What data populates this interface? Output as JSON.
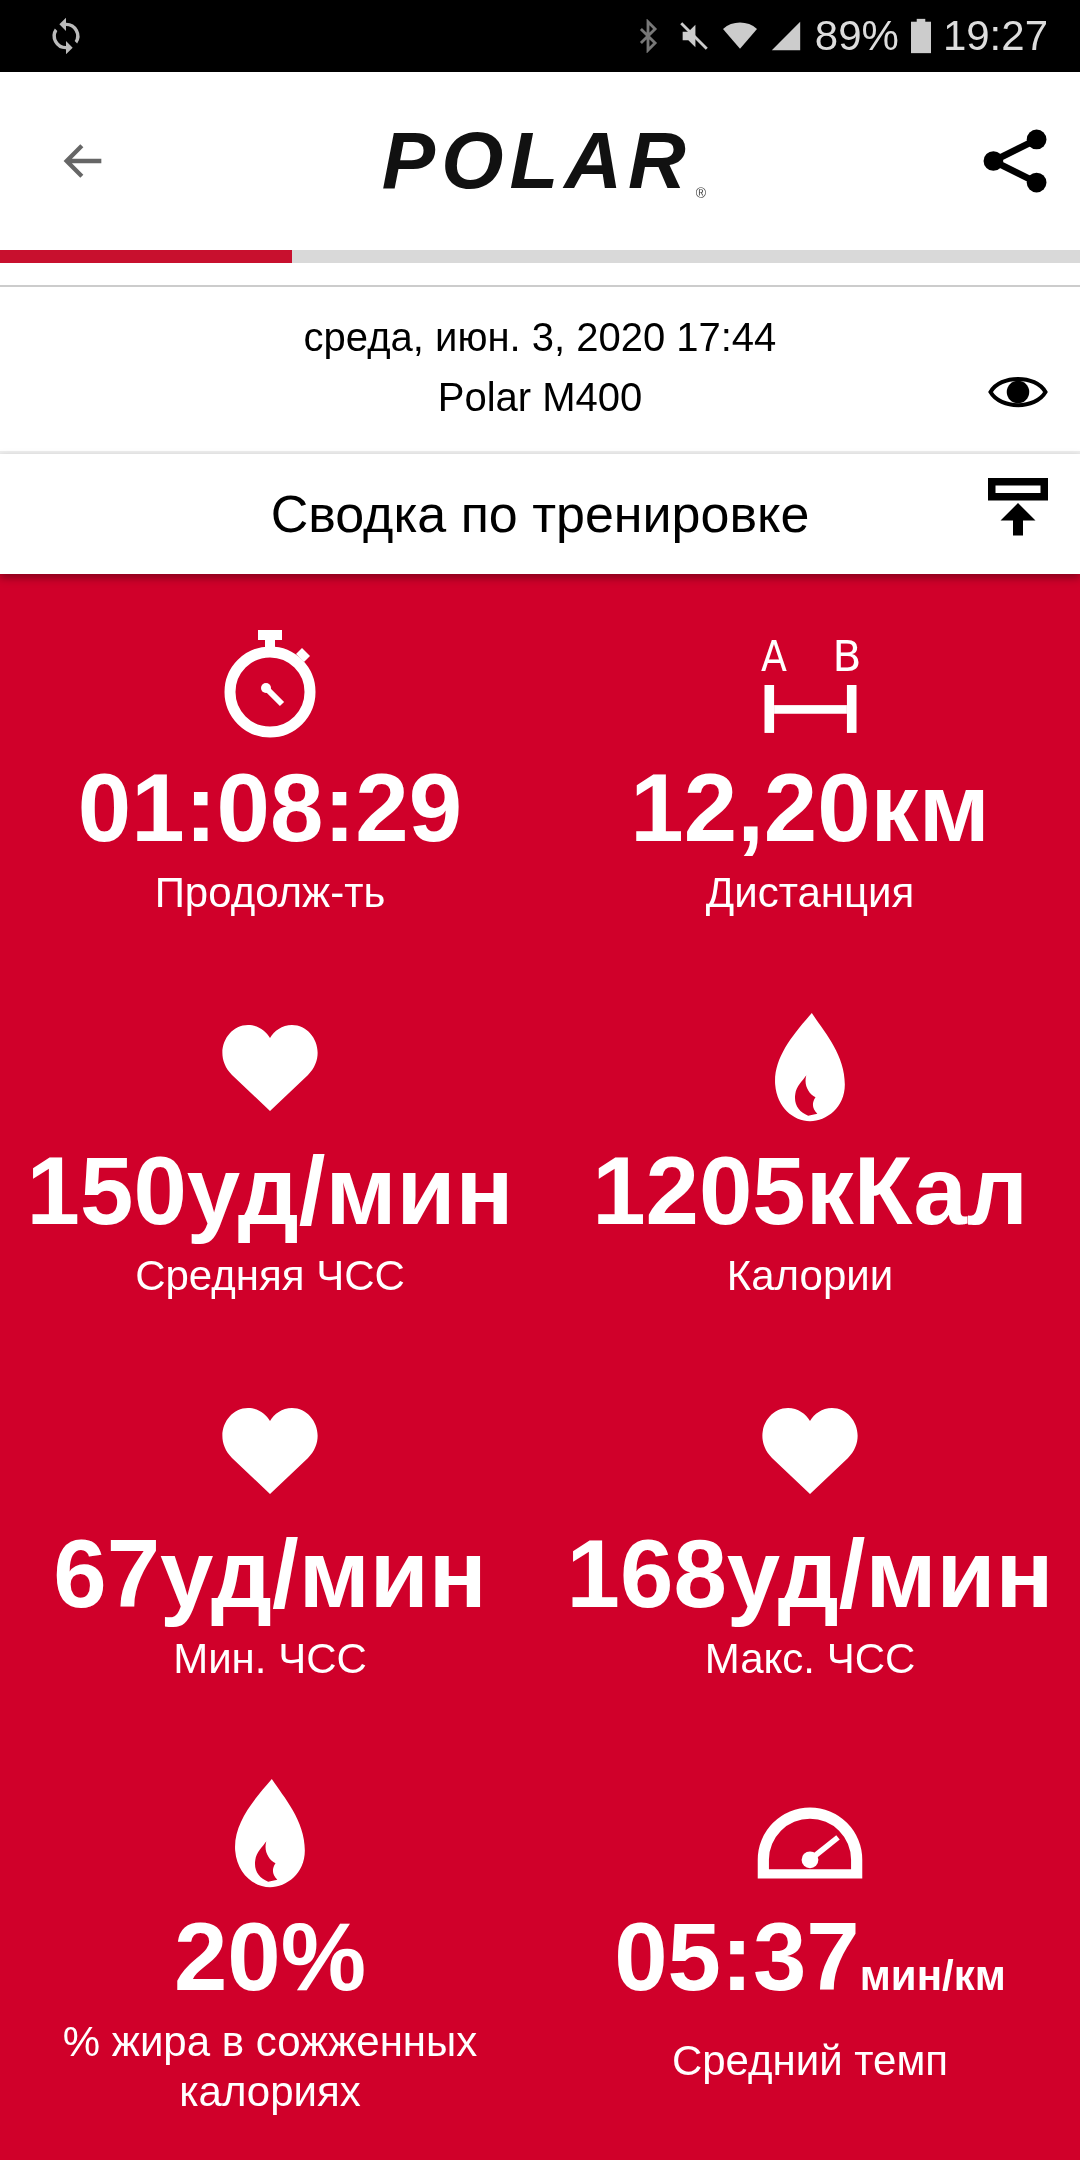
{
  "status_bar": {
    "battery": "89%",
    "time": "19:27"
  },
  "app_bar": {
    "logo": "POLAR",
    "logo_mark": "®"
  },
  "progress": {
    "level": 0.27
  },
  "session": {
    "date": "среда, июн. 3, 2020 17:44",
    "device": "Polar M400"
  },
  "section": {
    "title": "Сводка по тренировке"
  },
  "distance_marks": [
    "A",
    "B"
  ],
  "metrics": [
    {
      "kind": "stopwatch",
      "value": "01:08:29",
      "label": "Продолж-ть"
    },
    {
      "kind": "distance",
      "value": "12,20км",
      "label": "Дистанция"
    },
    {
      "kind": "heart",
      "value": "150уд/мин",
      "label": "Средняя ЧСС"
    },
    {
      "kind": "flame",
      "value": "1205кКал",
      "label": "Калории"
    },
    {
      "kind": "heart",
      "value": "67уд/мин",
      "label": "Мин. ЧСС"
    },
    {
      "kind": "heart",
      "value": "168уд/мин",
      "label": "Макс. ЧСС"
    },
    {
      "kind": "flame",
      "value": "20%",
      "label": "% жира в сожженных калориях"
    },
    {
      "kind": "gauge",
      "value": "05:37",
      "unit": "мин/км",
      "label": "Средний темп"
    }
  ]
}
